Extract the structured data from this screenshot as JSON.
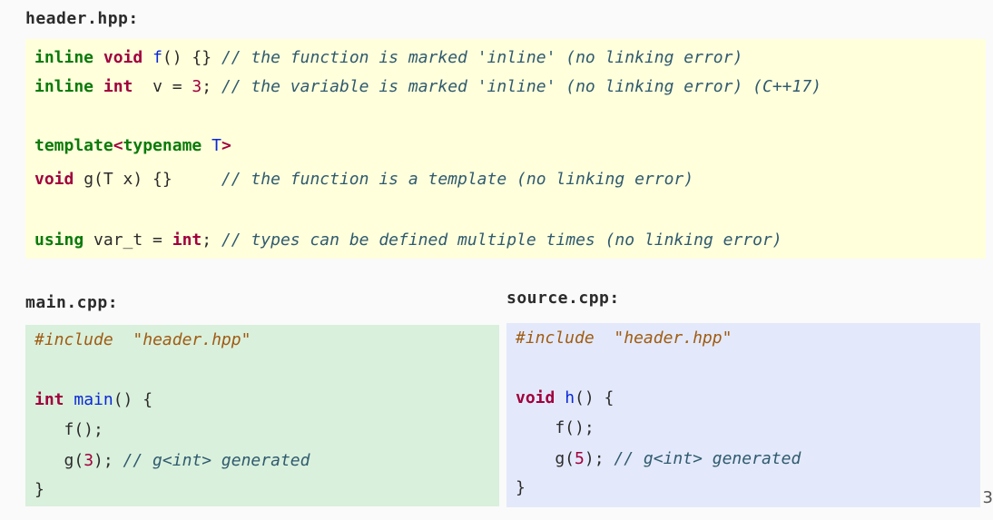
{
  "header_file": {
    "name": "header.hpp:",
    "line1": {
      "kw1": "inline",
      "ty": "void",
      "fn": "f",
      "rest": "() {} ",
      "comment": "// the function is marked 'inline' (no linking error)"
    },
    "line2": {
      "kw1": "inline",
      "ty": "int",
      "rest": "  v = ",
      "num": "3",
      "rest2": "; ",
      "comment": "// the variable is marked 'inline' (no linking error) (C++17)"
    },
    "line3": {
      "kw1": "template",
      "lt": "<",
      "kw2": "typename",
      "T": "T",
      "gt": ">"
    },
    "line4": {
      "ty": "void",
      "rest": " g(T x) {}     ",
      "comment": "// the function is a template (no linking error)"
    },
    "line5": {
      "kw1": "using",
      "rest": " var_t = ",
      "ty": "int",
      "rest2": "; ",
      "comment": "// types can be defined multiple times (no linking error)"
    }
  },
  "main_file": {
    "name": "main.cpp:",
    "include_directive": "#include",
    "include_path": "\"header.hpp\"",
    "sig_type": "int",
    "sig_fn": "main",
    "sig_rest": "() {",
    "call_f": "   f();",
    "call_g_pre": "   g(",
    "call_g_num": "3",
    "call_g_post": "); ",
    "call_g_comment": "// g<int> generated",
    "close": "}"
  },
  "source_file": {
    "name": "source.cpp:",
    "include_directive": "#include",
    "include_path": "\"header.hpp\"",
    "sig_type": "void",
    "sig_fn": "h",
    "sig_rest": "() {",
    "call_f": "    f();",
    "call_g_pre": "    g(",
    "call_g_num": "5",
    "call_g_post": "); ",
    "call_g_comment": "// g<int> generated",
    "close": "}"
  },
  "page_number": "3",
  "colors": {
    "header_bg": "#ffffdc",
    "main_bg": "#d9f0dc",
    "source_bg": "#e3e9fa",
    "keyword": "#0b7a0b",
    "type": "#a0003c",
    "function": "#0a28d8",
    "comment": "#2f5a6e",
    "preprocessor": "#a05b12"
  }
}
